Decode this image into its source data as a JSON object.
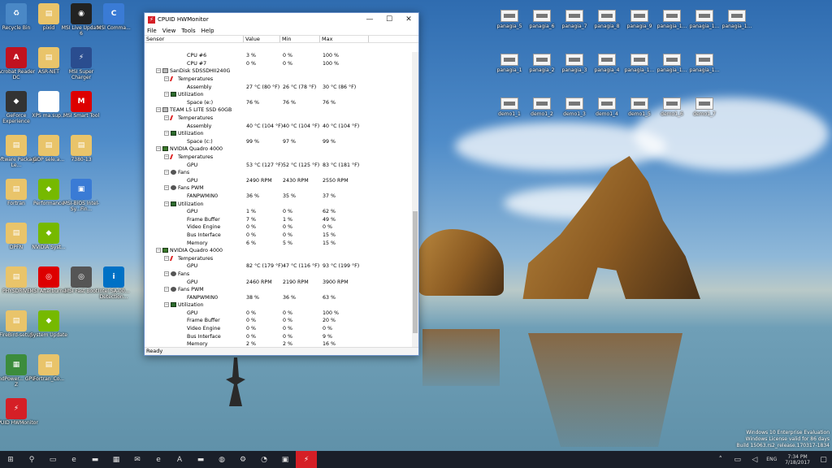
{
  "desktop": {
    "left_icons": [
      {
        "label": "Recycle Bin",
        "color": "#4a88c6",
        "glyph": "♻",
        "col": 0,
        "row": 0
      },
      {
        "label": "pixid",
        "color": "#e9c46a",
        "glyph": "▤",
        "col": 1,
        "row": 0
      },
      {
        "label": "MSI Live Update 6",
        "color": "#222",
        "glyph": "◉",
        "col": 2,
        "row": 0
      },
      {
        "label": "MSI Comma...",
        "color": "#3a7bd5",
        "glyph": "C",
        "col": 3,
        "row": 0
      },
      {
        "label": "Acrobat Reader DC",
        "color": "#c1121f",
        "glyph": "A",
        "col": 0,
        "row": 1
      },
      {
        "label": "ASR-NET",
        "color": "#e9c46a",
        "glyph": "▤",
        "col": 1,
        "row": 1
      },
      {
        "label": "MSI Super Charger",
        "color": "#2a4d8f",
        "glyph": "⚡",
        "col": 2,
        "row": 1
      },
      {
        "label": "GeForce Experience",
        "color": "#333",
        "glyph": "◆",
        "col": 0,
        "row": 2
      },
      {
        "label": "XPS ma.sup...",
        "color": "#fff",
        "glyph": "e",
        "col": 1,
        "row": 2
      },
      {
        "label": "MSI Smart Tool",
        "color": "#d00",
        "glyph": "M",
        "col": 2,
        "row": 2
      },
      {
        "label": "Software Package Le...",
        "color": "#e9c46a",
        "glyph": "▤",
        "col": 0,
        "row": 3
      },
      {
        "label": "GOP sele.a...",
        "color": "#e9c46a",
        "glyph": "▤",
        "col": 1,
        "row": 3
      },
      {
        "label": "7380-13",
        "color": "#e9c46a",
        "glyph": "▤",
        "col": 2,
        "row": 3
      },
      {
        "label": "Fortran",
        "color": "#e9c46a",
        "glyph": "▤",
        "col": 0,
        "row": 4
      },
      {
        "label": "Performance",
        "color": "#76b900",
        "glyph": "◆",
        "col": 1,
        "row": 4
      },
      {
        "label": "MSI-BIOS Intel-Sy...Fin...",
        "color": "#3a7bd5",
        "glyph": "▣",
        "col": 2,
        "row": 4
      },
      {
        "label": "DPFN",
        "color": "#e9c46a",
        "glyph": "▤",
        "col": 0,
        "row": 5
      },
      {
        "label": "NVIDIA Syst...",
        "color": "#76b900",
        "glyph": "◆",
        "col": 1,
        "row": 5
      },
      {
        "label": "PHYSDRIVE",
        "color": "#e9c46a",
        "glyph": "▤",
        "col": 0,
        "row": 6
      },
      {
        "label": "MSI Afterburner",
        "color": "#d00",
        "glyph": "◎",
        "col": 1,
        "row": 6
      },
      {
        "label": "MSI Fast Boot",
        "color": "#555",
        "glyph": "◎",
        "col": 2,
        "row": 6
      },
      {
        "label": "Intel SA-00... Detection...",
        "color": "#0071c5",
        "glyph": "i",
        "col": 3,
        "row": 6
      },
      {
        "label": "FireBird-setup",
        "color": "#e9c46a",
        "glyph": "▤",
        "col": 0,
        "row": 7
      },
      {
        "label": "System Update",
        "color": "#76b900",
        "glyph": "◆",
        "col": 1,
        "row": 7
      },
      {
        "label": "EndPower... GPU-Z",
        "color": "#3c8c3c",
        "glyph": "▦",
        "col": 0,
        "row": 8
      },
      {
        "label": "Fortran_Co...",
        "color": "#e9c46a",
        "glyph": "▤",
        "col": 1,
        "row": 8
      },
      {
        "label": "CPUID HWMonitor",
        "color": "#d51f26",
        "glyph": "⚡",
        "col": 0,
        "row": 9
      }
    ],
    "thumbnails": [
      {
        "label": "panagia_5",
        "col": 0,
        "row": 0
      },
      {
        "label": "panagia_6",
        "col": 1,
        "row": 0
      },
      {
        "label": "panagia_7",
        "col": 2,
        "row": 0
      },
      {
        "label": "panagia_8",
        "col": 3,
        "row": 0
      },
      {
        "label": "panagia_9",
        "col": 4,
        "row": 0
      },
      {
        "label": "panagia_1...",
        "col": 5,
        "row": 0
      },
      {
        "label": "panagia_1...",
        "col": 6,
        "row": 0
      },
      {
        "label": "panagia_1...",
        "col": 7,
        "row": 0
      },
      {
        "label": "panagia_1",
        "col": 0,
        "row": 1
      },
      {
        "label": "panagia_2",
        "col": 1,
        "row": 1
      },
      {
        "label": "panagia_3",
        "col": 2,
        "row": 1
      },
      {
        "label": "panagia_4",
        "col": 3,
        "row": 1
      },
      {
        "label": "panagia_1...",
        "col": 4,
        "row": 1
      },
      {
        "label": "panagia_1...",
        "col": 5,
        "row": 1
      },
      {
        "label": "panagia_1...",
        "col": 6,
        "row": 1
      },
      {
        "label": "demo1_1",
        "col": 0,
        "row": 2
      },
      {
        "label": "demo1_2",
        "col": 1,
        "row": 2
      },
      {
        "label": "demo1_3",
        "col": 2,
        "row": 2
      },
      {
        "label": "demo1_4",
        "col": 3,
        "row": 2
      },
      {
        "label": "demo1_5",
        "col": 4,
        "row": 2
      },
      {
        "label": "demo1_6",
        "col": 5,
        "row": 2
      },
      {
        "label": "demo1_7",
        "col": 6,
        "row": 2
      }
    ]
  },
  "window": {
    "title": "CPUID HWMonitor",
    "menu": [
      "File",
      "View",
      "Tools",
      "Help"
    ],
    "columns": [
      "Sensor",
      "Value",
      "Min",
      "Max"
    ],
    "status": "Ready",
    "rows": [
      {
        "level": 4,
        "icon": "",
        "label": "CPU #6",
        "value": "3 %",
        "min": "0 %",
        "max": "100 %"
      },
      {
        "level": 4,
        "icon": "",
        "label": "CPU #7",
        "value": "0 %",
        "min": "0 %",
        "max": "100 %"
      },
      {
        "level": 1,
        "icon": "drive",
        "label": "SanDisk SDSSDHII240G",
        "value": "",
        "min": "",
        "max": ""
      },
      {
        "level": 2,
        "icon": "temp",
        "label": "Temperatures",
        "value": "",
        "min": "",
        "max": ""
      },
      {
        "level": 4,
        "icon": "",
        "label": "Assembly",
        "value": "27 °C  (80 °F)",
        "min": "26 °C  (78 °F)",
        "max": "30 °C  (86 °F)"
      },
      {
        "level": 2,
        "icon": "util",
        "label": "Utilization",
        "value": "",
        "min": "",
        "max": ""
      },
      {
        "level": 4,
        "icon": "",
        "label": "Space (e:)",
        "value": "76 %",
        "min": "76 %",
        "max": "76 %"
      },
      {
        "level": 1,
        "icon": "drive",
        "label": "TEAM L5 LITE SSD 60GB",
        "value": "",
        "min": "",
        "max": ""
      },
      {
        "level": 2,
        "icon": "temp",
        "label": "Temperatures",
        "value": "",
        "min": "",
        "max": ""
      },
      {
        "level": 4,
        "icon": "",
        "label": "Assembly",
        "value": "40 °C  (104 °F)",
        "min": "40 °C  (104 °F)",
        "max": "40 °C  (104 °F)"
      },
      {
        "level": 2,
        "icon": "util",
        "label": "Utilization",
        "value": "",
        "min": "",
        "max": ""
      },
      {
        "level": 4,
        "icon": "",
        "label": "Space (c:)",
        "value": "99 %",
        "min": "97 %",
        "max": "99 %"
      },
      {
        "level": 1,
        "icon": "gpu",
        "label": "NVIDIA Quadro 4000",
        "value": "",
        "min": "",
        "max": ""
      },
      {
        "level": 2,
        "icon": "temp",
        "label": "Temperatures",
        "value": "",
        "min": "",
        "max": ""
      },
      {
        "level": 4,
        "icon": "",
        "label": "GPU",
        "value": "53 °C  (127 °F)",
        "min": "52 °C  (125 °F)",
        "max": "83 °C  (181 °F)"
      },
      {
        "level": 2,
        "icon": "fan",
        "label": "Fans",
        "value": "",
        "min": "",
        "max": ""
      },
      {
        "level": 4,
        "icon": "",
        "label": "GPU",
        "value": "2490 RPM",
        "min": "2430 RPM",
        "max": "2550 RPM"
      },
      {
        "level": 2,
        "icon": "fan",
        "label": "Fans PWM",
        "value": "",
        "min": "",
        "max": ""
      },
      {
        "level": 4,
        "icon": "",
        "label": "FANPWMIN0",
        "value": "36 %",
        "min": "35 %",
        "max": "37 %"
      },
      {
        "level": 2,
        "icon": "util",
        "label": "Utilization",
        "value": "",
        "min": "",
        "max": ""
      },
      {
        "level": 4,
        "icon": "",
        "label": "GPU",
        "value": "1 %",
        "min": "0 %",
        "max": "62 %"
      },
      {
        "level": 4,
        "icon": "",
        "label": "Frame Buffer",
        "value": "7 %",
        "min": "1 %",
        "max": "49 %"
      },
      {
        "level": 4,
        "icon": "",
        "label": "Video Engine",
        "value": "0 %",
        "min": "0 %",
        "max": "0 %"
      },
      {
        "level": 4,
        "icon": "",
        "label": "Bus Interface",
        "value": "0 %",
        "min": "0 %",
        "max": "15 %"
      },
      {
        "level": 4,
        "icon": "",
        "label": "Memory",
        "value": "6 %",
        "min": "5 %",
        "max": "15 %"
      },
      {
        "level": 1,
        "icon": "gpu",
        "label": "NVIDIA Quadro 4000",
        "value": "",
        "min": "",
        "max": ""
      },
      {
        "level": 2,
        "icon": "temp",
        "label": "Temperatures",
        "value": "",
        "min": "",
        "max": ""
      },
      {
        "level": 4,
        "icon": "",
        "label": "GPU",
        "value": "82 °C  (179 °F)",
        "min": "47 °C  (116 °F)",
        "max": "93 °C  (199 °F)"
      },
      {
        "level": 2,
        "icon": "fan",
        "label": "Fans",
        "value": "",
        "min": "",
        "max": ""
      },
      {
        "level": 4,
        "icon": "",
        "label": "GPU",
        "value": "2460 RPM",
        "min": "2190 RPM",
        "max": "3900 RPM"
      },
      {
        "level": 2,
        "icon": "fan",
        "label": "Fans PWM",
        "value": "",
        "min": "",
        "max": ""
      },
      {
        "level": 4,
        "icon": "",
        "label": "FANPWMIN0",
        "value": "38 %",
        "min": "36 %",
        "max": "63 %"
      },
      {
        "level": 2,
        "icon": "util",
        "label": "Utilization",
        "value": "",
        "min": "",
        "max": ""
      },
      {
        "level": 4,
        "icon": "",
        "label": "GPU",
        "value": "0 %",
        "min": "0 %",
        "max": "100 %"
      },
      {
        "level": 4,
        "icon": "",
        "label": "Frame Buffer",
        "value": "0 %",
        "min": "0 %",
        "max": "20 %"
      },
      {
        "level": 4,
        "icon": "",
        "label": "Video Engine",
        "value": "0 %",
        "min": "0 %",
        "max": "0 %"
      },
      {
        "level": 4,
        "icon": "",
        "label": "Bus Interface",
        "value": "0 %",
        "min": "0 %",
        "max": "9 %"
      },
      {
        "level": 4,
        "icon": "",
        "label": "Memory",
        "value": "2 %",
        "min": "2 %",
        "max": "16 %"
      }
    ]
  },
  "watermark": {
    "line1": "Windows 10 Enterprise Evaluation",
    "line2": "Windows License valid for 86 days",
    "line3": "Build 15063.rs2_release.170317-1834"
  },
  "taskbar": {
    "apps": [
      {
        "name": "start-button",
        "glyph": "⊞"
      },
      {
        "name": "search-icon",
        "glyph": "⚲"
      },
      {
        "name": "task-view-icon",
        "glyph": "▭"
      },
      {
        "name": "edge-icon",
        "glyph": "e"
      },
      {
        "name": "file-explorer-icon",
        "glyph": "▬"
      },
      {
        "name": "store-icon",
        "glyph": "▦"
      },
      {
        "name": "mail-icon",
        "glyph": "✉"
      },
      {
        "name": "ie-icon",
        "glyph": "e"
      },
      {
        "name": "acrobat-icon",
        "glyph": "A"
      },
      {
        "name": "folder-icon",
        "glyph": "▬"
      },
      {
        "name": "network-icon",
        "glyph": "◍"
      },
      {
        "name": "settings-icon",
        "glyph": "⚙"
      },
      {
        "name": "compass-icon",
        "glyph": "◔"
      },
      {
        "name": "app-icon",
        "glyph": "▣"
      },
      {
        "name": "hwmonitor-icon",
        "glyph": "⚡"
      }
    ],
    "language": "ENG",
    "time": "7:34 PM",
    "date": "7/18/2017"
  }
}
